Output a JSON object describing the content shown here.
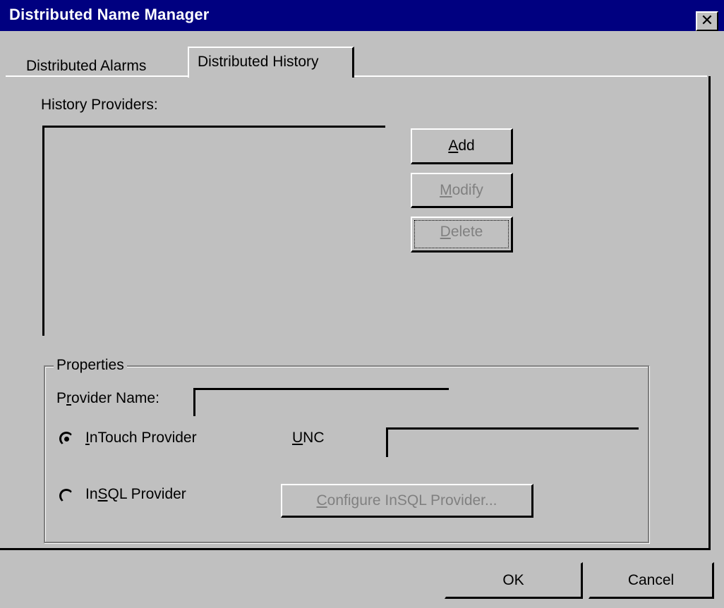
{
  "window": {
    "title": "Distributed Name Manager",
    "close_symbol": "✕"
  },
  "tabs": {
    "alarms": "Distributed Alarms",
    "history": "Distributed History",
    "active": "Distributed History"
  },
  "history_providers": {
    "label": "History Providers:",
    "items": []
  },
  "buttons": {
    "add": {
      "pre": "",
      "acc": "A",
      "post": "dd"
    },
    "modify": {
      "pre": "",
      "acc": "M",
      "post": "odify"
    },
    "delete": {
      "pre": "",
      "acc": "D",
      "post": "elete"
    },
    "configure": {
      "pre": "",
      "acc": "C",
      "post": "onfigure InSQL Provider..."
    },
    "ok": "OK",
    "cancel": "Cancel"
  },
  "properties": {
    "legend": "Properties",
    "provider_name": {
      "pre": "P",
      "acc": "r",
      "post": "ovider Name:",
      "value": ""
    },
    "intouch": {
      "pre": "",
      "acc": "I",
      "post": "nTouch Provider",
      "selected": true
    },
    "insql": {
      "pre": "In",
      "acc": "S",
      "post": "QL Provider",
      "selected": false
    },
    "unc": {
      "pre": "",
      "acc": "U",
      "post": "NC",
      "value": ""
    }
  }
}
